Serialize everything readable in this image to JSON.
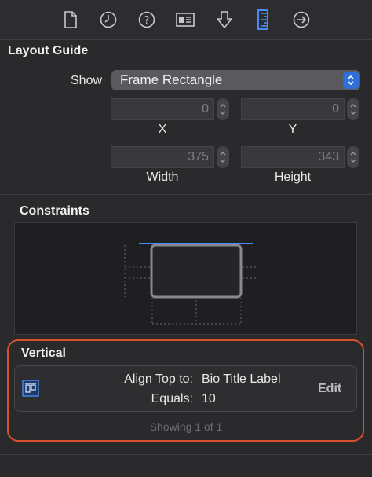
{
  "toolbar": {
    "icons": [
      "file-inspector-icon",
      "history-inspector-icon",
      "quick-help-icon",
      "identity-inspector-icon",
      "attributes-inspector-icon",
      "size-inspector-icon",
      "connections-inspector-icon"
    ],
    "active": "size-inspector-icon",
    "active_color": "#4a8bf5"
  },
  "layout_guide": {
    "title": "Layout Guide",
    "show_label": "Show",
    "show_value": "Frame Rectangle",
    "x_value": "0",
    "y_value": "0",
    "x_label": "X",
    "y_label": "Y",
    "width_value": "375",
    "height_value": "343",
    "width_label": "Width",
    "height_label": "Height"
  },
  "constraints": {
    "title": "Constraints"
  },
  "vertical": {
    "title": "Vertical",
    "highlight_color": "#d8502c",
    "align_key": "Align Top to:",
    "align_value": "Bio Title Label",
    "equals_key": "Equals:",
    "equals_value": "10",
    "edit_label": "Edit",
    "showing": "Showing 1 of 1"
  }
}
